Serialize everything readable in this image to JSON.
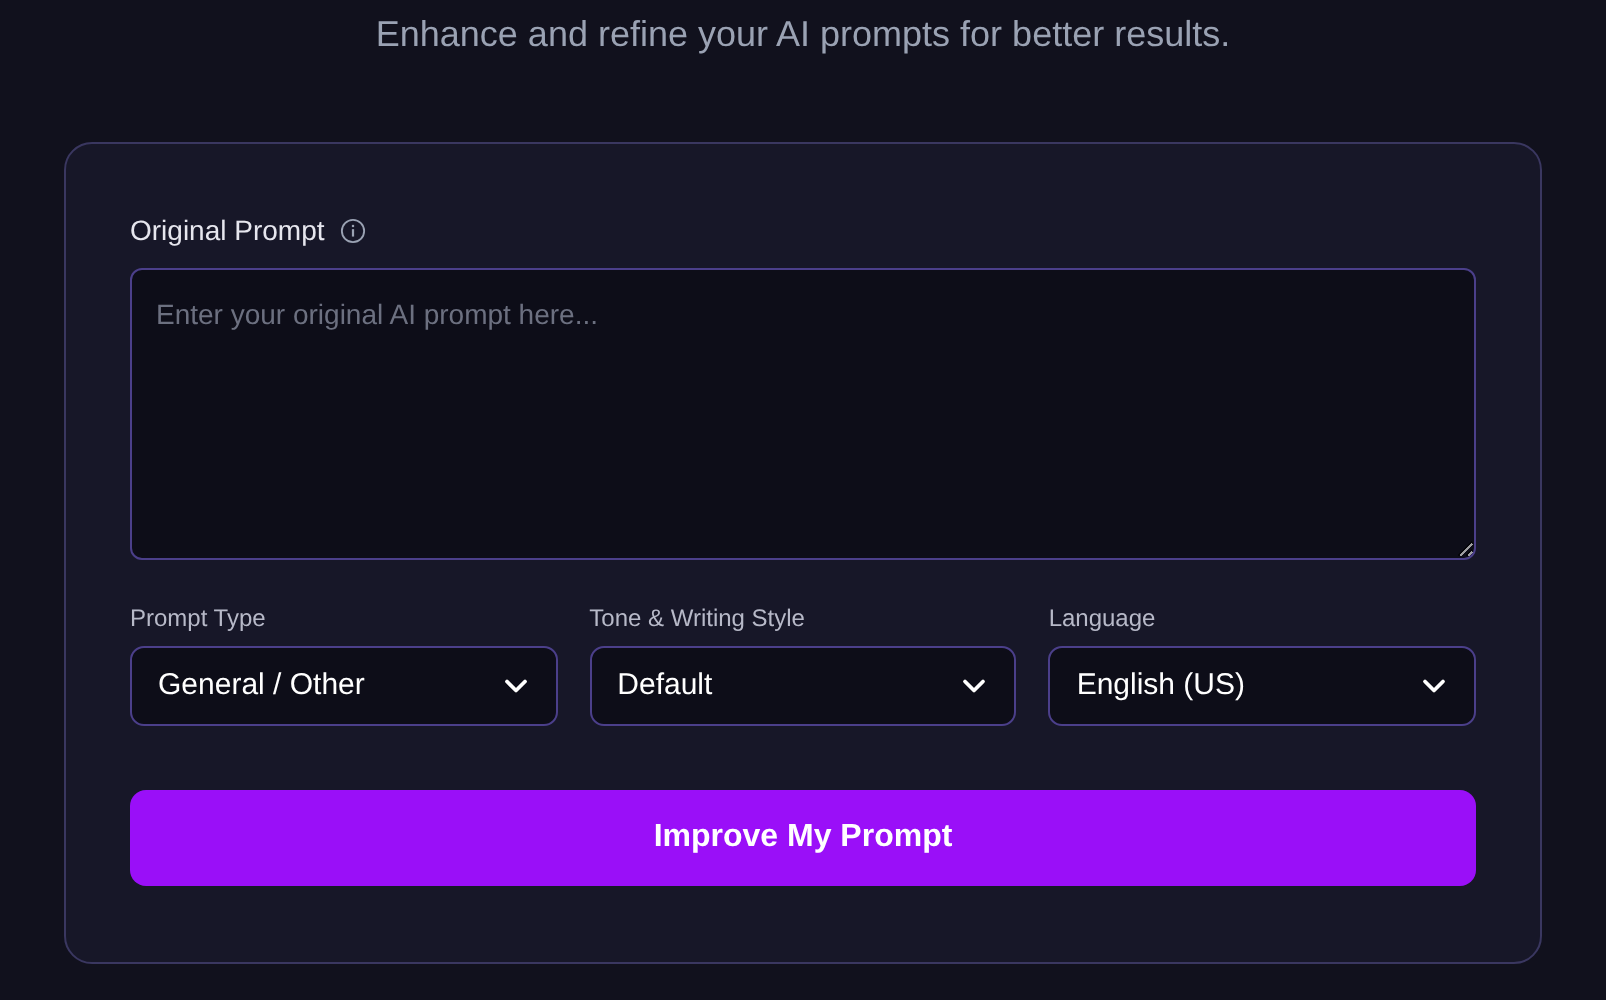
{
  "subtitle": "Enhance and refine your AI prompts for better results.",
  "prompt_field": {
    "label": "Original Prompt",
    "placeholder": "Enter your original AI prompt here..."
  },
  "selects": [
    {
      "label": "Prompt Type",
      "value": "General / Other"
    },
    {
      "label": "Tone & Writing Style",
      "value": "Default"
    },
    {
      "label": "Language",
      "value": "English (US)"
    }
  ],
  "submit_button": "Improve My Prompt"
}
